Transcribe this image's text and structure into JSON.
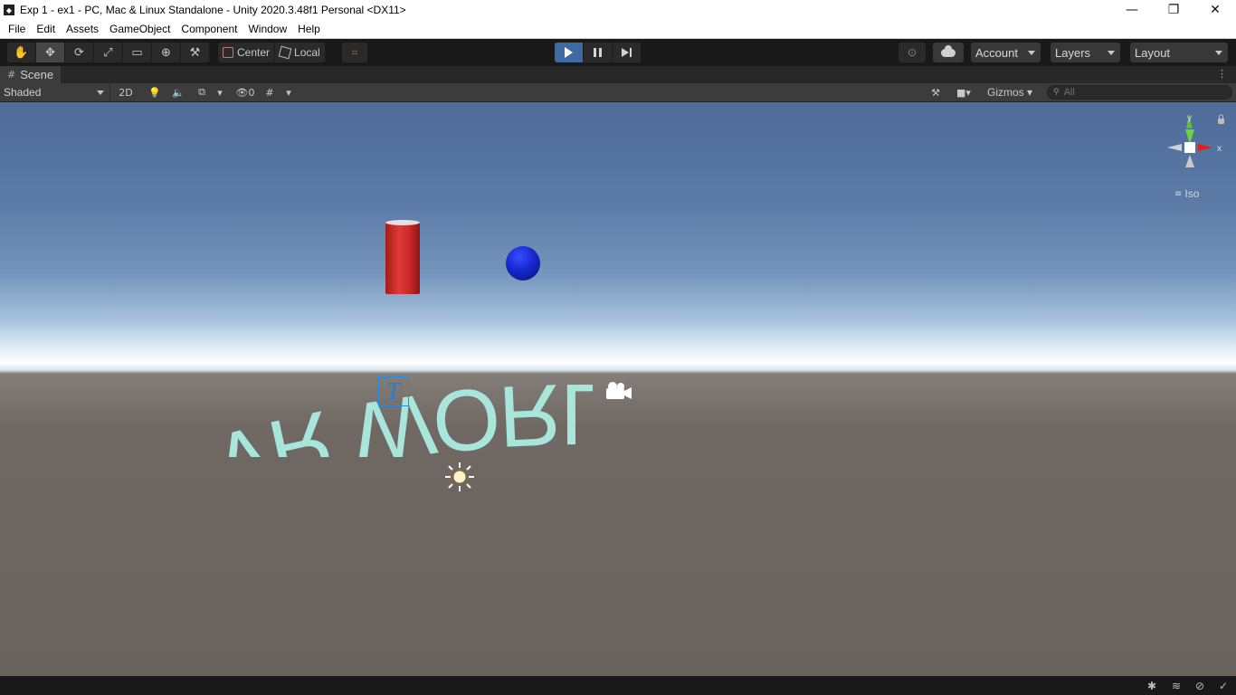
{
  "window": {
    "title": "Exp 1 - ex1 - PC, Mac & Linux Standalone - Unity 2020.3.48f1 Personal <DX11>",
    "minimize_glyph": "—",
    "maximize_glyph": "❐",
    "close_glyph": "✕"
  },
  "menu": [
    "File",
    "Edit",
    "Assets",
    "GameObject",
    "Component",
    "Window",
    "Help"
  ],
  "toolbar": {
    "tools": [
      {
        "name": "hand-tool",
        "glyph": "✋",
        "active": false
      },
      {
        "name": "move-tool",
        "glyph": "✥",
        "active": true
      },
      {
        "name": "rotate-tool",
        "glyph": "⟳",
        "active": false
      },
      {
        "name": "scale-tool",
        "glyph": "⤢",
        "active": false
      },
      {
        "name": "rect-tool",
        "glyph": "▭",
        "active": false
      },
      {
        "name": "transform-tool",
        "glyph": "⊕",
        "active": false
      },
      {
        "name": "custom-tool",
        "glyph": "⚒",
        "active": false
      }
    ],
    "pivot_label": "Center",
    "rotation_label": "Local",
    "snap_glyph": "⌗",
    "account": "Account",
    "layers": "Layers",
    "layout": "Layout"
  },
  "scene_tab": {
    "label": "Scene",
    "hash": "#",
    "menu_glyph": "⋮"
  },
  "scene_toolbar": {
    "shading_mode": "Shaded",
    "mode_2d": "2D",
    "hidden_count": "0",
    "gizmos": "Gizmos",
    "search_placeholder": "All"
  },
  "viewport": {
    "text_object": "VR WORLD",
    "text_gizmo_glyph": "T",
    "orientation_gizmo": {
      "y": "y",
      "x": "x"
    },
    "projection_label": "Iso",
    "colors": {
      "cylinder": "#d42e2e",
      "sphere": "#1a2ee0",
      "text_mesh": "#a8e6dc",
      "sky_top": "#4e6b99",
      "ground": "#6a625d"
    }
  }
}
